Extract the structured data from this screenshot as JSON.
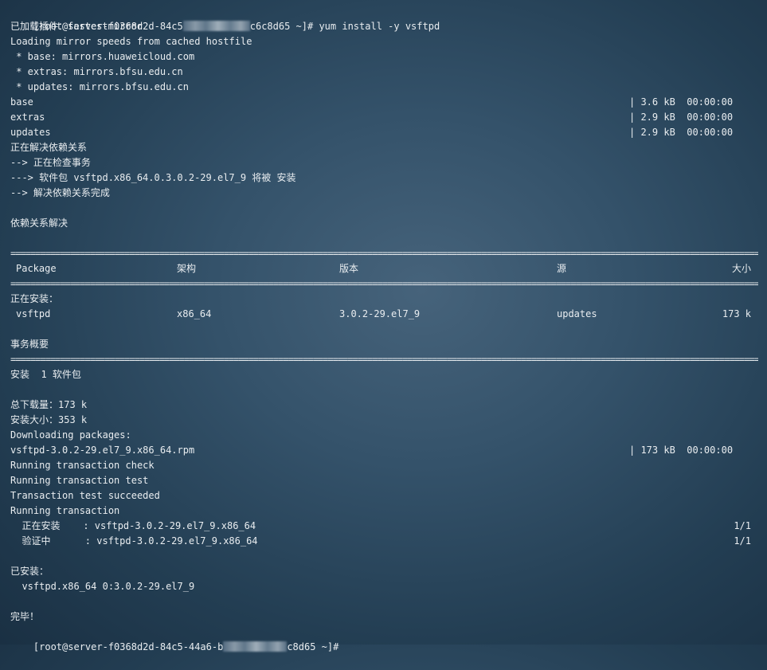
{
  "prompt": {
    "first_prefix": "[root@server-f0368d2d-84c5",
    "first_suffix": "c6c8d65 ~]# ",
    "command": "yum install -y vsftpd",
    "last_prefix": "[root@server-f0368d2d-84c5-44a6-b",
    "last_suffix": "c8d65 ~]# "
  },
  "header_lines": [
    "已加载插件：fastestmirror",
    "Loading mirror speeds from cached hostfile",
    " * base: mirrors.huaweicloud.com",
    " * extras: mirrors.bfsu.edu.cn",
    " * updates: mirrors.bfsu.edu.cn"
  ],
  "repos": [
    {
      "name": "base",
      "size": "| 3.6 kB  00:00:00"
    },
    {
      "name": "extras",
      "size": "| 2.9 kB  00:00:00"
    },
    {
      "name": "updates",
      "size": "| 2.9 kB  00:00:00"
    }
  ],
  "resolve_lines": [
    "正在解决依赖关系",
    "--> 正在检查事务",
    "---> 软件包 vsftpd.x86_64.0.3.0.2-29.el7_9 将被 安装",
    "--> 解决依赖关系完成"
  ],
  "deps_resolved": "依赖关系解决",
  "separator": "================================================================================================================================================================================",
  "table": {
    "headers": {
      "package": "Package",
      "arch": "架构",
      "version": "版本",
      "repo": "源",
      "size": "大小"
    },
    "installing_label": "正在安装：",
    "row": {
      "package": "vsftpd",
      "arch": "x86_64",
      "version": "3.0.2-29.el7_9",
      "repo": "updates",
      "size": "173 k"
    }
  },
  "summary": {
    "title": "事务概要",
    "install_line": "安装  1 软件包",
    "total_download": "总下载量：173 k",
    "install_size": "安装大小：353 k",
    "downloading": "Downloading packages:"
  },
  "rpm": {
    "name": "vsftpd-3.0.2-29.el7_9.x86_64.rpm",
    "size": "| 173 kB  00:00:00"
  },
  "transaction_lines": [
    "Running transaction check",
    "Running transaction test",
    "Transaction test succeeded",
    "Running transaction"
  ],
  "progress": [
    {
      "label": "  正在安装    : vsftpd-3.0.2-29.el7_9.x86_64",
      "count": "1/1"
    },
    {
      "label": "  验证中      : vsftpd-3.0.2-29.el7_9.x86_64",
      "count": "1/1"
    }
  ],
  "installed": {
    "title": "已安装：",
    "item": "  vsftpd.x86_64 0:3.0.2-29.el7_9"
  },
  "done": "完毕！"
}
